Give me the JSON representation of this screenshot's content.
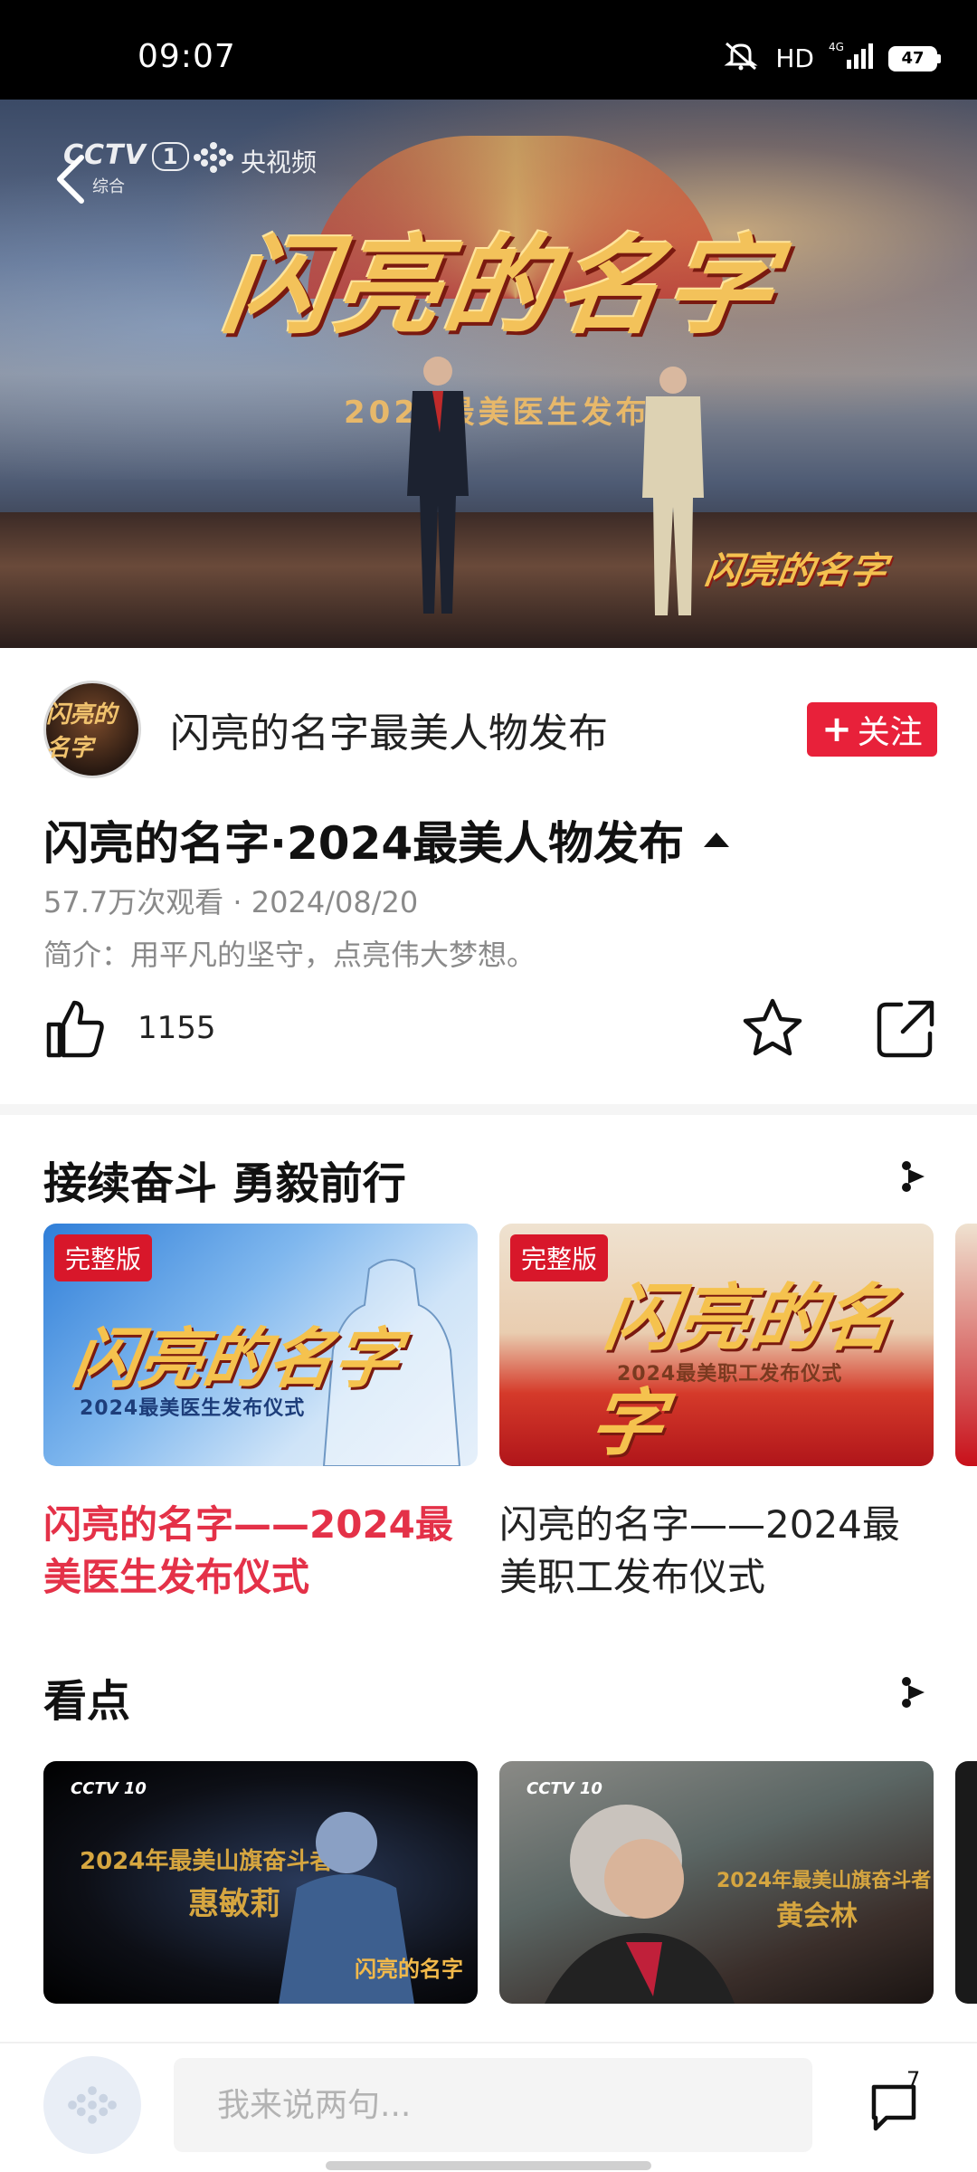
{
  "status_bar": {
    "time": "09:07",
    "network": "HD",
    "signal": "4G",
    "battery": "47"
  },
  "video": {
    "logo_cctv": "CCTV",
    "logo_channel_number": "1",
    "logo_channel_name": "综合",
    "logo_platform": "央视频",
    "banner_title": "闪亮的名字",
    "banner_subtitle": "2024最美医生发布",
    "watermark": "闪亮的名字"
  },
  "channel": {
    "avatar_text": "闪亮的名字",
    "name": "闪亮的名字最美人物发布",
    "follow_label": "关注"
  },
  "video_info": {
    "title": "闪亮的名字·2024最美人物发布",
    "meta": "57.7万次观看 · 2024/08/20",
    "intro": "简介：用平凡的坚守，点亮伟大梦想。"
  },
  "actions": {
    "like_count": "1155"
  },
  "section1": {
    "title": "接续奋斗 勇毅前行",
    "cards": [
      {
        "badge": "完整版",
        "thumb_title": "闪亮的名字",
        "thumb_caption": "2024最美医生发布仪式",
        "title": "闪亮的名字——2024最美医生发布仪式"
      },
      {
        "badge": "完整版",
        "thumb_title": "闪亮的名字",
        "thumb_caption": "2024最美职工发布仪式",
        "title": "闪亮的名字——2024最美职工发布仪式"
      }
    ]
  },
  "section2": {
    "title": "看点",
    "cards": [
      {
        "logo": "CCTV 10",
        "headline": "2024年最美山旗奋斗者",
        "name": "惠敏莉",
        "watermark": "闪亮的名字"
      },
      {
        "logo": "CCTV 10",
        "headline": "2024年最美山旗奋斗者",
        "name": "黄会林"
      }
    ]
  },
  "bottom_bar": {
    "comment_placeholder": "我来说两句...",
    "comment_count": "7"
  },
  "colors": {
    "accent_red": "#e8213a",
    "active_title_red": "#e43148",
    "meta_gray": "#8a8a8a"
  }
}
